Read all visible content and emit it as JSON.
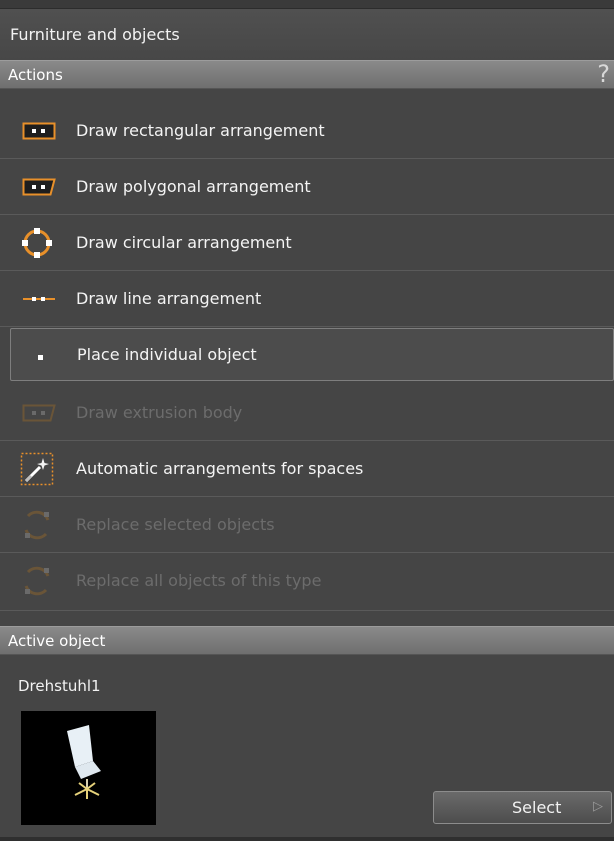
{
  "panel": {
    "title": "Furniture and objects"
  },
  "actions": {
    "header": "Actions",
    "help": "?",
    "items": [
      {
        "label": "Draw rectangular arrangement",
        "icon": "rect-arrangement-icon",
        "enabled": true
      },
      {
        "label": "Draw polygonal arrangement",
        "icon": "polygon-arrangement-icon",
        "enabled": true
      },
      {
        "label": "Draw circular arrangement",
        "icon": "circle-arrangement-icon",
        "enabled": true
      },
      {
        "label": "Draw line arrangement",
        "icon": "line-arrangement-icon",
        "enabled": true
      },
      {
        "label": "Place individual object",
        "icon": "single-object-icon",
        "enabled": true,
        "selected": true
      },
      {
        "label": "Draw extrusion body",
        "icon": "extrusion-icon",
        "enabled": false
      },
      {
        "label": "Automatic arrangements for spaces",
        "icon": "magic-wand-icon",
        "enabled": true
      },
      {
        "label": "Replace selected objects",
        "icon": "replace-icon",
        "enabled": false
      },
      {
        "label": "Replace all objects of this type",
        "icon": "replace-all-icon",
        "enabled": false
      }
    ]
  },
  "active_object": {
    "header": "Active object",
    "name": "Drehstuhl1",
    "select_label": "Select",
    "select_arrow": "▷"
  },
  "colors": {
    "accent": "#e8902a",
    "background": "#454545",
    "header": "#7a7a7a"
  }
}
